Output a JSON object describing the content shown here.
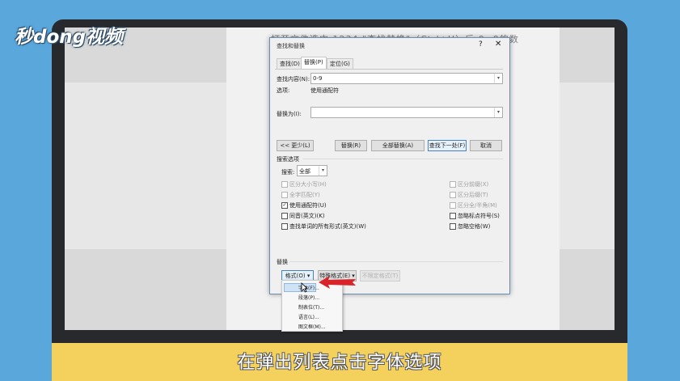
{
  "logo": {
    "text": "秒dong视频"
  },
  "document": {
    "background_text": "打开文件选中    1234  \"查找替换\"（Ctrl+H）后    0~9的数"
  },
  "dialog": {
    "title": "查找和替换",
    "help": "?",
    "close": "✕",
    "tabs": [
      {
        "label": "查找(D)"
      },
      {
        "label": "替换(P)"
      },
      {
        "label": "定位(G)"
      }
    ],
    "find_label": "查找内容(N):",
    "find_value": "0-9",
    "options_label": "选项:",
    "options_value": "使用通配符",
    "replace_label": "替换为(I):",
    "replace_value": "",
    "buttons": {
      "less": "<< 更少(L)",
      "replace": "替换(R)",
      "replace_all": "全部替换(A)",
      "find_next": "查找下一处(F)",
      "cancel": "取消"
    },
    "search_options_title": "搜索选项",
    "search_label": "搜索:",
    "search_value": "全部",
    "left_options": [
      {
        "label": "区分大小写(H)",
        "checked": false,
        "disabled": true
      },
      {
        "label": "全字匹配(Y)",
        "checked": false,
        "disabled": true
      },
      {
        "label": "使用通配符(U)",
        "checked": true,
        "disabled": false
      },
      {
        "label": "同音(英文)(K)",
        "checked": false,
        "disabled": false
      },
      {
        "label": "查找单词的所有形式(英文)(W)",
        "checked": false,
        "disabled": false
      }
    ],
    "right_options": [
      {
        "label": "区分前缀(X)",
        "checked": false,
        "disabled": true
      },
      {
        "label": "区分后缀(T)",
        "checked": false,
        "disabled": true
      },
      {
        "label": "区分全/半角(M)",
        "checked": false,
        "disabled": true
      },
      {
        "label": "忽略标点符号(S)",
        "checked": false,
        "disabled": false
      },
      {
        "label": "忽略空格(W)",
        "checked": false,
        "disabled": false
      }
    ],
    "replace_section_title": "替换",
    "format_button": "格式(O) ▾",
    "special_button": "特殊格式(E) ▾",
    "no_format_button": "不限定格式(T)"
  },
  "format_menu": {
    "items": [
      {
        "label": "字体(F)..."
      },
      {
        "label": "段落(P)..."
      },
      {
        "label": "制表位(T)..."
      },
      {
        "label": "语言(L)..."
      },
      {
        "label": "图文框(M)..."
      }
    ]
  },
  "caption": {
    "text": "在弹出列表点击字体选项"
  },
  "colors": {
    "caption_bar": "#f4d15c",
    "background": "#5aa7dc",
    "arrow": "#d8232a"
  }
}
